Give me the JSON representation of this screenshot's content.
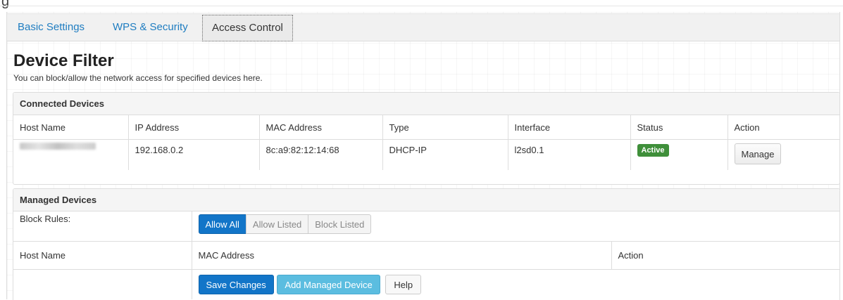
{
  "window": {
    "top_glyph": "g"
  },
  "tabs": [
    {
      "label": "Basic Settings",
      "active": false
    },
    {
      "label": "WPS & Security",
      "active": false
    },
    {
      "label": "Access Control",
      "active": true
    }
  ],
  "page": {
    "title": "Device Filter",
    "description": "You can block/allow the network access for specified devices here."
  },
  "connected_devices": {
    "title": "Connected Devices",
    "columns": [
      "Host Name",
      "IP Address",
      "MAC Address",
      "Type",
      "Interface",
      "Status",
      "Action"
    ],
    "rows": [
      {
        "host_name": "",
        "ip_address": "192.168.0.2",
        "mac_address": "8c:a9:82:12:14:68",
        "type": "DHCP-IP",
        "interface": "l2sd0.1",
        "status": "Active",
        "action_label": "Manage"
      }
    ]
  },
  "managed_devices": {
    "title": "Managed Devices",
    "block_rules_label": "Block Rules:",
    "block_rule_options": [
      "Allow All",
      "Allow Listed",
      "Block Listed"
    ],
    "selected_rule": "Allow All",
    "columns": [
      "Host Name",
      "MAC Address",
      "Action"
    ],
    "buttons": {
      "save": "Save Changes",
      "add": "Add Managed Device",
      "help": "Help"
    }
  },
  "colors": {
    "accent": "#1275c8",
    "info": "#5bbde0",
    "success": "#3f8f3a",
    "link": "#1f7dc1"
  }
}
